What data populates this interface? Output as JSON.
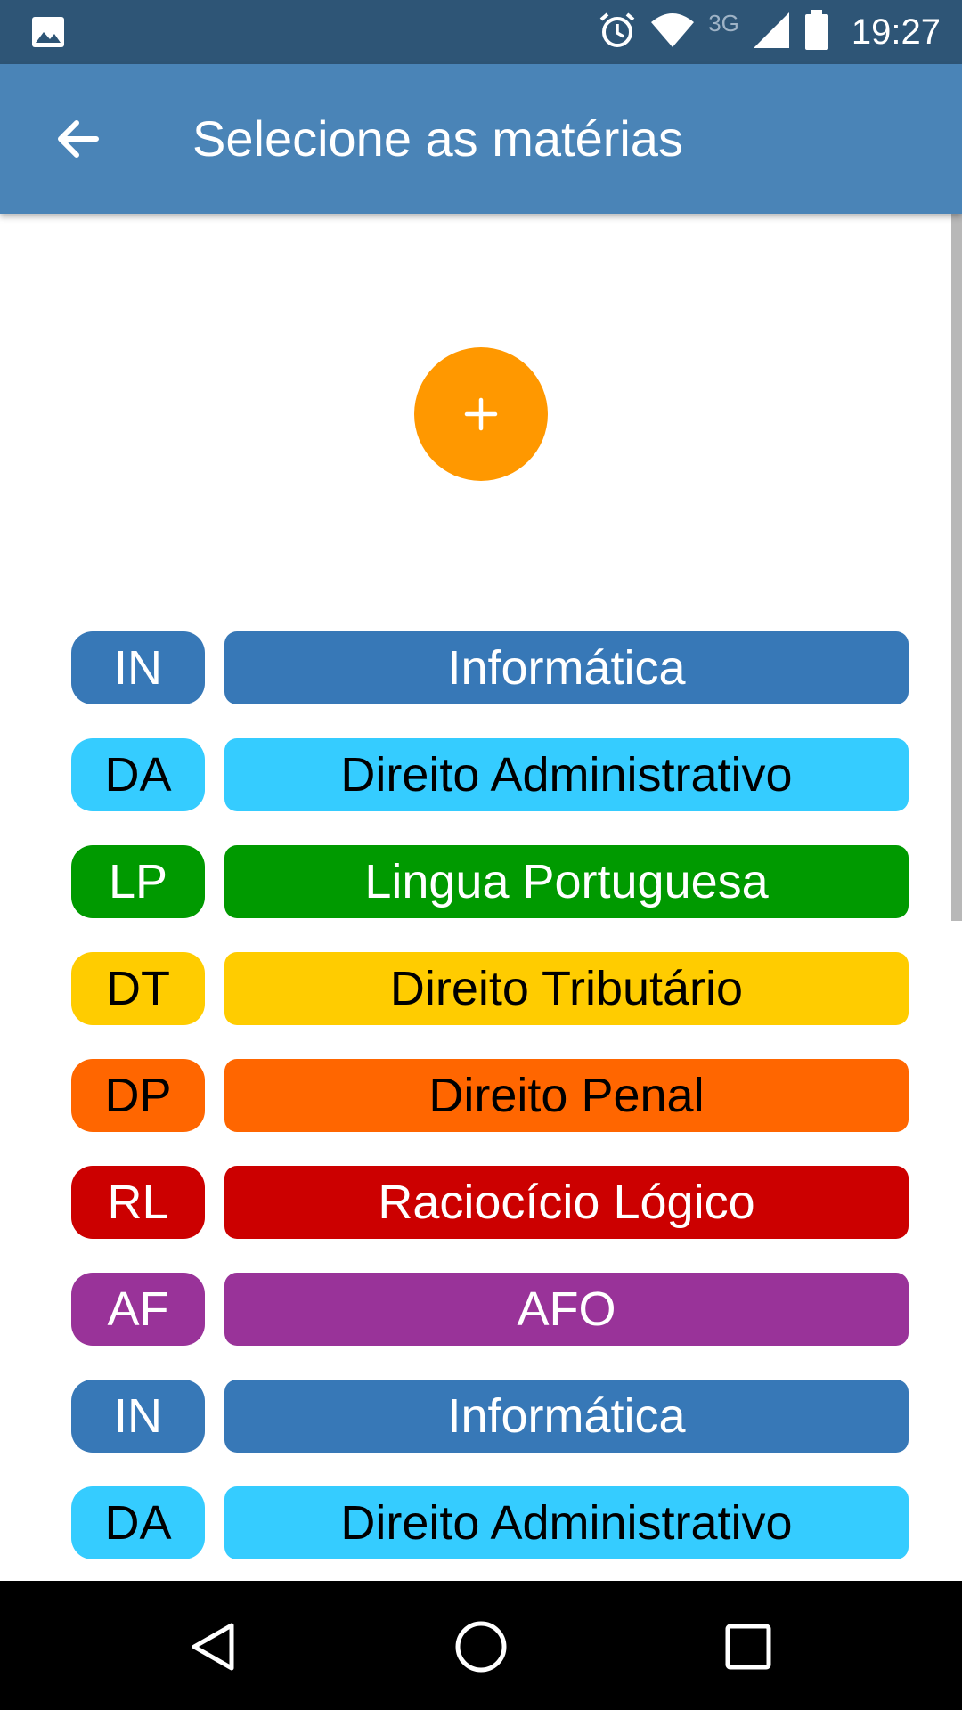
{
  "status_bar": {
    "network_type": "3G",
    "time": "19:27",
    "icons": [
      "image-icon",
      "alarm-icon",
      "wifi-icon",
      "signal-icon",
      "battery-icon"
    ]
  },
  "app_bar": {
    "title": "Selecione as matérias",
    "back_icon": "arrow-back-icon"
  },
  "fab": {
    "icon": "plus-icon",
    "color": "#ff9800"
  },
  "subjects": [
    {
      "abbr": "IN",
      "name": "Informática",
      "color": "#3778b7",
      "text_color": "#ffffff"
    },
    {
      "abbr": "DA",
      "name": "Direito Administrativo",
      "color": "#35ccff",
      "text_color": "#000000"
    },
    {
      "abbr": "LP",
      "name": "Lingua Portuguesa",
      "color": "#009a00",
      "text_color": "#ffffff"
    },
    {
      "abbr": "DT",
      "name": "Direito Tributário",
      "color": "#ffcc00",
      "text_color": "#000000"
    },
    {
      "abbr": "DP",
      "name": "Direito Penal",
      "color": "#ff6600",
      "text_color": "#000000"
    },
    {
      "abbr": "RL",
      "name": "Raciocício Lógico",
      "color": "#cc0000",
      "text_color": "#ffffff"
    },
    {
      "abbr": "AF",
      "name": "AFO",
      "color": "#993399",
      "text_color": "#ffffff"
    },
    {
      "abbr": "IN",
      "name": "Informática",
      "color": "#3778b7",
      "text_color": "#ffffff"
    },
    {
      "abbr": "DA",
      "name": "Direito Administrativo",
      "color": "#35ccff",
      "text_color": "#000000"
    }
  ],
  "nav_bar": {
    "icons": [
      "back-triangle-icon",
      "home-circle-icon",
      "recents-square-icon"
    ]
  },
  "colors": {
    "status_bar": "#2e5576",
    "app_bar": "#4a84b7"
  }
}
